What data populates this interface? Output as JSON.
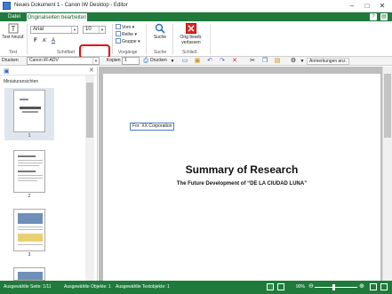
{
  "window": {
    "title": "Neues Dokument 1 - Canon iW Desktop - Editor"
  },
  "tabs": [
    {
      "label": "Datei"
    },
    {
      "label": "Originalseiten bearbeiten"
    }
  ],
  "ribbon": {
    "text_add": "Text hinzuf.",
    "group_text": "Text",
    "font_name": "Arial",
    "font_size": "10",
    "group_font": "Schriftart",
    "bold": "F",
    "italic": "K",
    "color": "A",
    "arrange_front": "Vorn",
    "arrange_order": "Reihe",
    "arrange_group": "Gruppe",
    "group_process": "Vorgänge",
    "search": "Suche",
    "group_search": "Suche",
    "close_edit": "Orig bearb. verlassen",
    "group_close": "Schließ"
  },
  "toolbar": {
    "print_label": "Drucken",
    "printer": "Canon iR-ADV",
    "copies_label": "Kopien",
    "copies": "1",
    "print_button": "Drucken",
    "annotations": "Anmerkungen anz."
  },
  "sidebar": {
    "title": "Miniaturansichten",
    "pages": [
      {
        "num": "1"
      },
      {
        "num": "2"
      },
      {
        "num": "3"
      }
    ]
  },
  "document": {
    "textbox": "For: XX Corporation",
    "title": "Summary of Research",
    "subtitle": "The Future Development of “DE LA CIUDAD LUNA”"
  },
  "status": {
    "pages": "Ausgewählte Seite: 1/11",
    "objects": "Ausgewählte Objekte: 1",
    "textfields": "Ausgewählte Textobjekte: 1",
    "zoom": "90%"
  }
}
